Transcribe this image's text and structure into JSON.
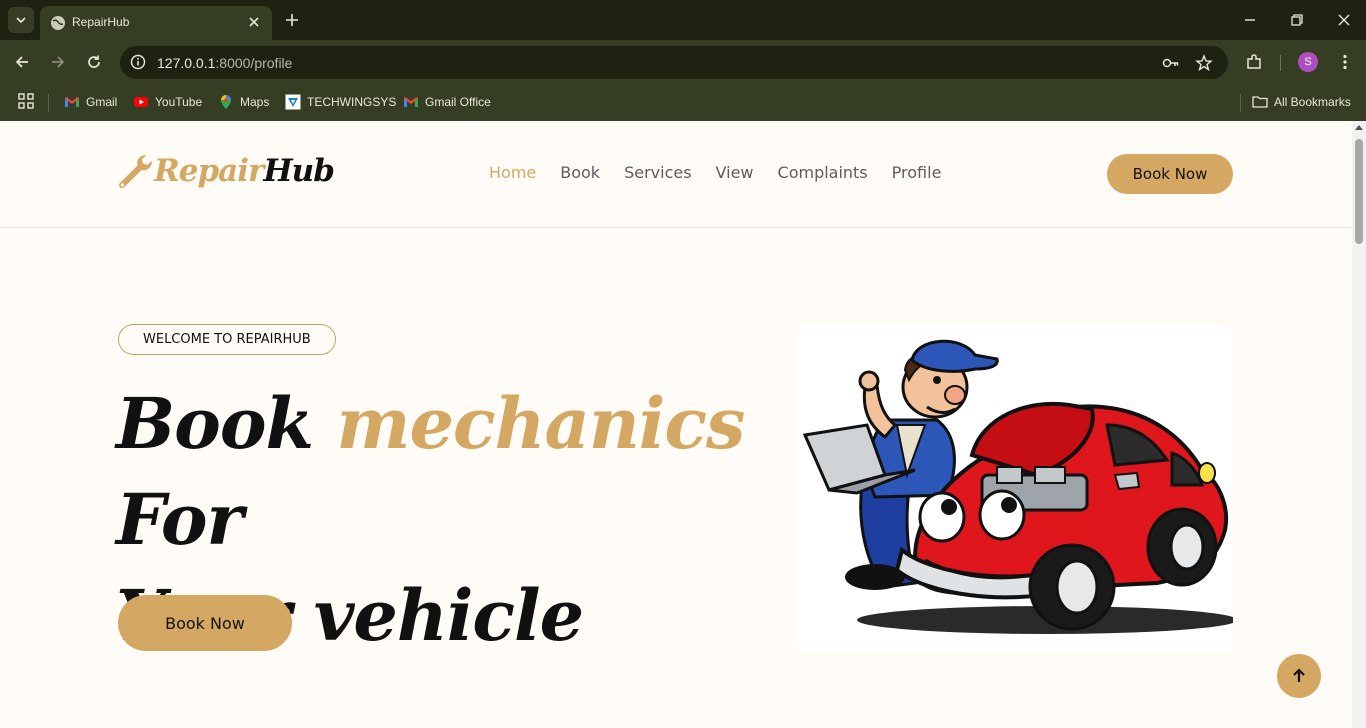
{
  "browser": {
    "tab_title": "RepairHub",
    "url_host": "127.0.0.1",
    "url_rest": ":8000/profile",
    "profile_initial": "S",
    "bookmarks": [
      {
        "label": "Gmail",
        "icon": "gmail-icon"
      },
      {
        "label": "YouTube",
        "icon": "youtube-icon"
      },
      {
        "label": "Maps",
        "icon": "maps-icon"
      },
      {
        "label": "TECHWINGSYS",
        "icon": "techwingsys-icon"
      },
      {
        "label": "Gmail Office",
        "icon": "gmail-icon"
      }
    ],
    "all_bookmarks": "All Bookmarks"
  },
  "site": {
    "logo_repair": "Repair",
    "logo_hub": "Hub",
    "nav": [
      "Home",
      "Book",
      "Services",
      "View",
      "Complaints",
      "Profile"
    ],
    "active_nav": "Home",
    "header_cta": "Book Now"
  },
  "hero": {
    "badge": "WELCOME TO REPAIRHUB",
    "headline_1": "Book",
    "headline_accent": "mechanics",
    "headline_2": "For",
    "headline_3": "Your vehicle",
    "cta": "Book Now",
    "image": "mechanic-with-laptop-and-red-car-illustration"
  },
  "colors": {
    "accent": "#d4a762",
    "browser_dark": "#1d2211",
    "browser_toolbar": "#353d22",
    "page_bg": "#fffbf6"
  }
}
